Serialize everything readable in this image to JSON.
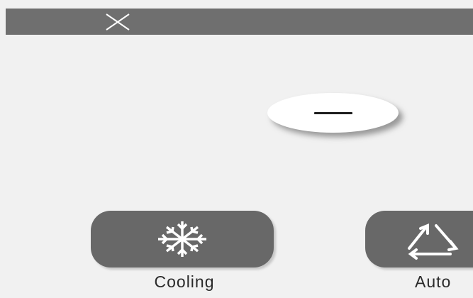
{
  "header": {
    "close_icon": "close-icon"
  },
  "controls": {
    "minus_icon": "minus-icon"
  },
  "modes": [
    {
      "label": "Cooling",
      "icon": "snowflake-icon"
    },
    {
      "label": "Auto",
      "icon": "auto-cycle-icon"
    }
  ],
  "colors": {
    "topbar": "#6f6f6f",
    "tile": "#686868",
    "background": "#f1f1f1",
    "icon": "#ffffff"
  }
}
